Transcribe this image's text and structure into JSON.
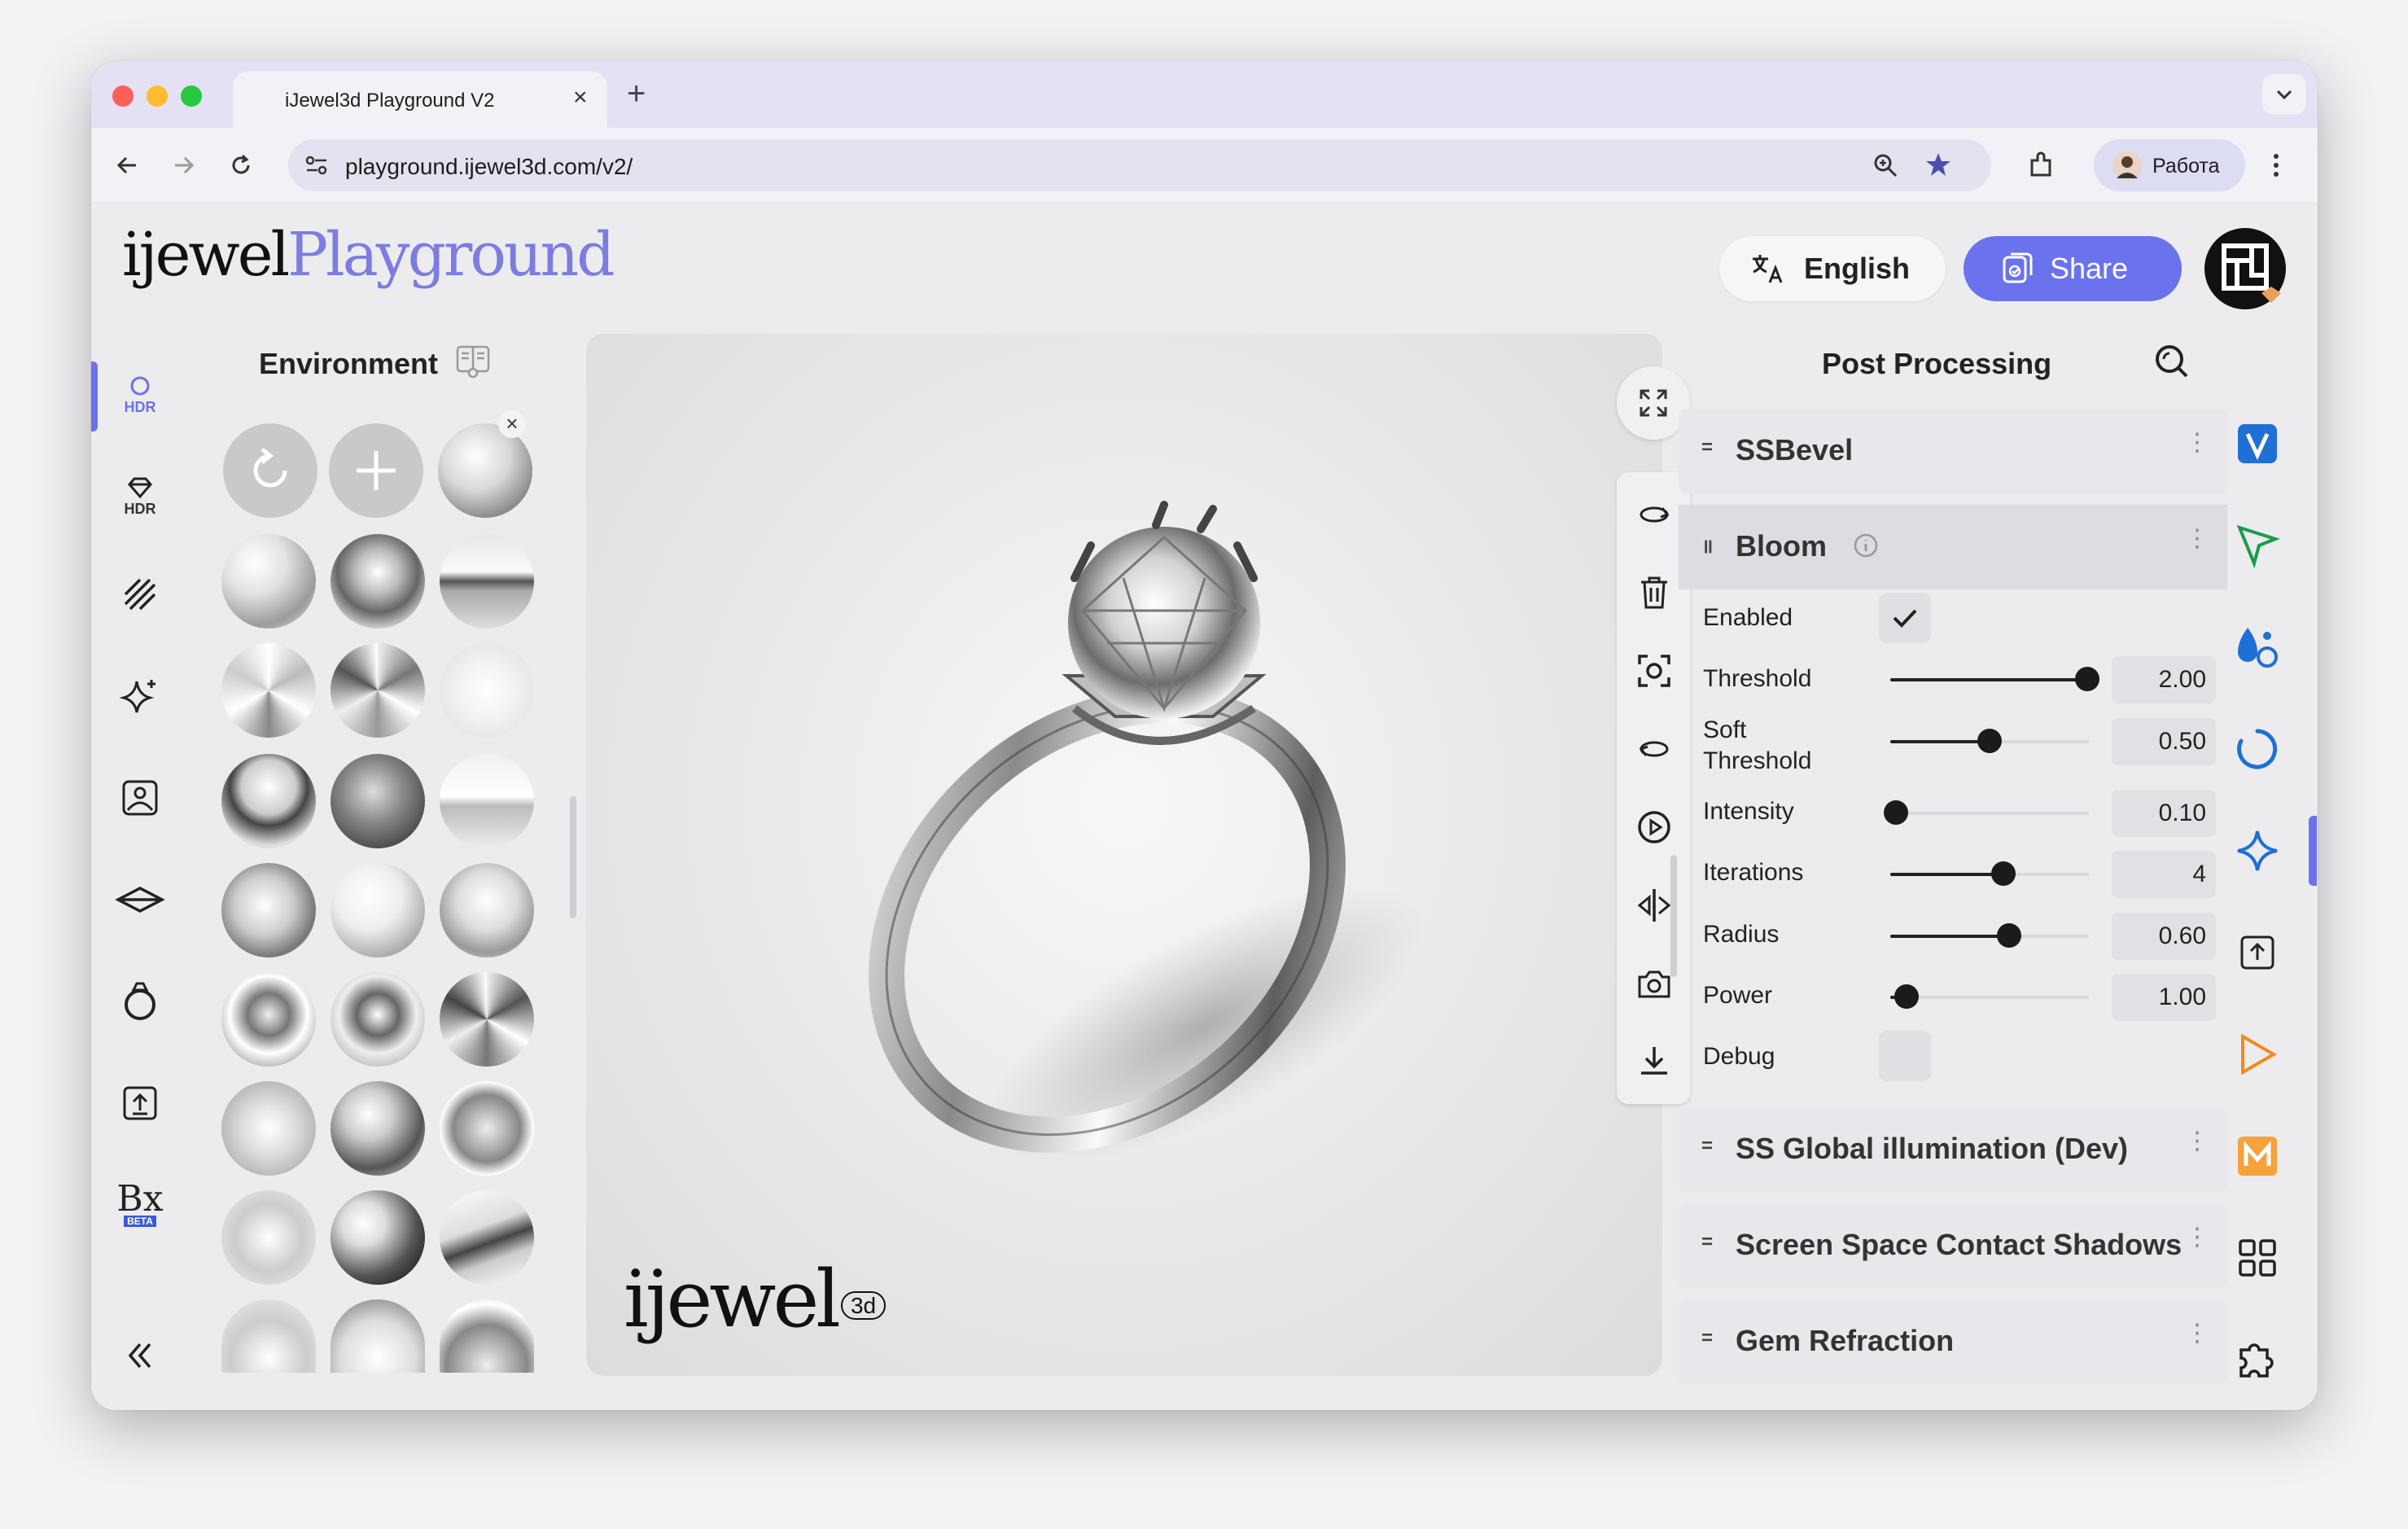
{
  "browser": {
    "tab_title": "iJewel3d Playground V2",
    "url": "playground.ijewel3d.com/v2/",
    "profile_label": "Работа"
  },
  "header": {
    "logo_primary": "ijewel",
    "logo_secondary": "Playground",
    "language_label": "English",
    "share_label": "Share"
  },
  "rail": {
    "hdr_label": "HDR",
    "hdr2_label": "HDR",
    "bx_label": "Bx",
    "beta_label": "BETA"
  },
  "environment": {
    "title": "Environment"
  },
  "viewport": {
    "watermark": "ijewel",
    "watermark_badge": "3d"
  },
  "post_processing": {
    "title": "Post Processing",
    "sections": [
      {
        "label": "SSBevel"
      },
      {
        "label": "Bloom"
      },
      {
        "label": "SS Global illumination (Dev)"
      },
      {
        "label": "Screen Space Contact Shadows"
      },
      {
        "label": "Gem Refraction"
      }
    ],
    "bloom": {
      "enabled_label": "Enabled",
      "enabled": true,
      "debug_label": "Debug",
      "debug": false,
      "params": [
        {
          "label": "Threshold",
          "value": "2.00",
          "fraction": 0.99
        },
        {
          "label": "Soft Threshold",
          "label_line1": "Soft",
          "label_line2": "Threshold",
          "value": "0.50",
          "fraction": 0.5
        },
        {
          "label": "Intensity",
          "value": "0.10",
          "fraction": 0.03
        },
        {
          "label": "Iterations",
          "value": "4",
          "fraction": 0.57
        },
        {
          "label": "Radius",
          "value": "0.60",
          "fraction": 0.6
        },
        {
          "label": "Power",
          "value": "1.00",
          "fraction": 0.08
        }
      ]
    }
  },
  "colors": {
    "accent": "#6b72ee",
    "logo_secondary": "#7b7de0",
    "rail_blue": "#1f6fd6",
    "rail_green": "#1a9c48",
    "rail_orange": "#f28a1a"
  }
}
